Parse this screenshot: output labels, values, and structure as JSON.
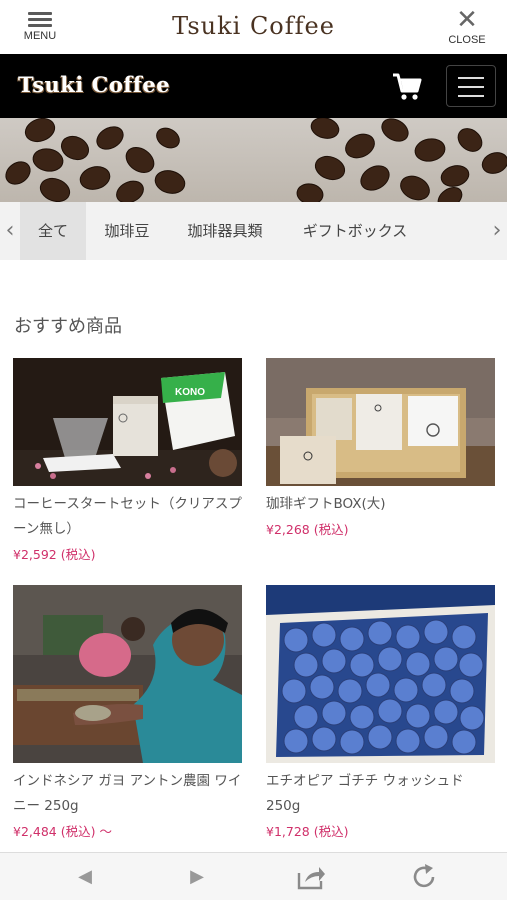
{
  "appbar": {
    "menu_label": "MENU",
    "title": "Tsuki Coffee",
    "close_label": "CLOSE"
  },
  "header": {
    "brand": "Tsuki Coffee"
  },
  "tabs": [
    {
      "label": "全て",
      "active": true
    },
    {
      "label": "珈琲豆"
    },
    {
      "label": "珈琲器具類"
    },
    {
      "label": "ギフトボックス"
    }
  ],
  "section_title": "おすすめ商品",
  "products": [
    {
      "name": "コーヒースタートセット（クリアスプーン無し）",
      "price": "¥2,592 (税込)"
    },
    {
      "name": "珈琲ギフトBOX(大)",
      "price": "¥2,268 (税込)"
    },
    {
      "name": "インドネシア ガヨ アントン農園 ワイニー 250g",
      "price": "¥2,484 (税込) 〜"
    },
    {
      "name": "エチオピア ゴチチ ウォッシュド 250g",
      "price": "¥1,728 (税込)"
    }
  ],
  "product_image_text": {
    "kono_label": "KONO"
  },
  "colors": {
    "price": "#d0306a",
    "header_bg": "#000000",
    "brand_text": "#4a3322"
  },
  "icons": [
    "menu-icon",
    "close-icon",
    "cart-icon",
    "hamburger-icon",
    "chevron-left-icon",
    "chevron-right-icon",
    "back-icon",
    "forward-icon",
    "share-icon",
    "reload-icon"
  ]
}
